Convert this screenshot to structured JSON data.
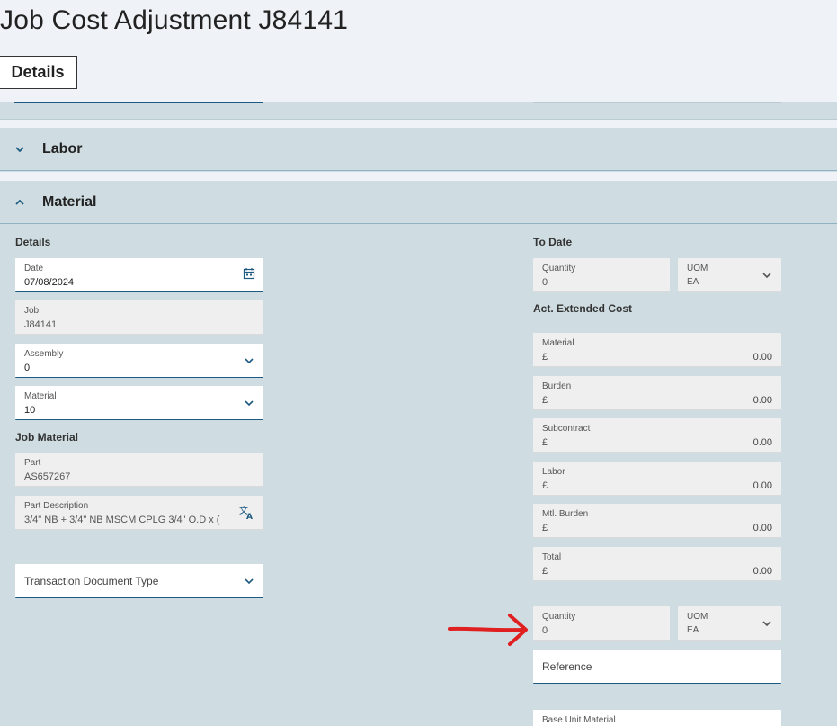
{
  "header": {
    "title": "Job Cost Adjustment J84141",
    "tab_label": "Details"
  },
  "sections": {
    "labor": "Labor",
    "material": "Material"
  },
  "details": {
    "group_label": "Details",
    "date": {
      "label": "Date",
      "value": "07/08/2024"
    },
    "job": {
      "label": "Job",
      "value": "J84141"
    },
    "assembly": {
      "label": "Assembly",
      "value": "0"
    },
    "material": {
      "label": "Material",
      "value": "10"
    }
  },
  "job_material": {
    "group_label": "Job Material",
    "part": {
      "label": "Part",
      "value": "AS657267"
    },
    "part_description": {
      "label": "Part Description",
      "value": "3/4\" NB + 3/4\" NB MSCM CPLG 3/4\" O.D x ("
    },
    "transaction_doc_type": {
      "placeholder": "Transaction Document Type"
    }
  },
  "to_date": {
    "group_label": "To Date",
    "quantity": {
      "label": "Quantity",
      "value": "0"
    },
    "uom": {
      "label": "UOM",
      "value": "EA"
    }
  },
  "act_extended_cost": {
    "group_label": "Act. Extended Cost",
    "items": [
      {
        "label": "Material",
        "currency": "£",
        "amount": "0.00"
      },
      {
        "label": "Burden",
        "currency": "£",
        "amount": "0.00"
      },
      {
        "label": "Subcontract",
        "currency": "£",
        "amount": "0.00"
      },
      {
        "label": "Labor",
        "currency": "£",
        "amount": "0.00"
      },
      {
        "label": "Mtl. Burden",
        "currency": "£",
        "amount": "0.00"
      },
      {
        "label": "Total",
        "currency": "£",
        "amount": "0.00"
      }
    ]
  },
  "adjustment": {
    "quantity": {
      "label": "Quantity",
      "value": "0"
    },
    "uom": {
      "label": "UOM",
      "value": "EA"
    },
    "reference": {
      "placeholder": "Reference"
    },
    "base_unit_material": {
      "label": "Base Unit Material"
    }
  },
  "colors": {
    "accent": "#1d5a82",
    "panel": "#cfdde2",
    "annotation": "#e02020"
  },
  "icons": {
    "calendar": "calendar-icon",
    "chevron": "chevron-down-icon",
    "translate": "translate-icon"
  }
}
